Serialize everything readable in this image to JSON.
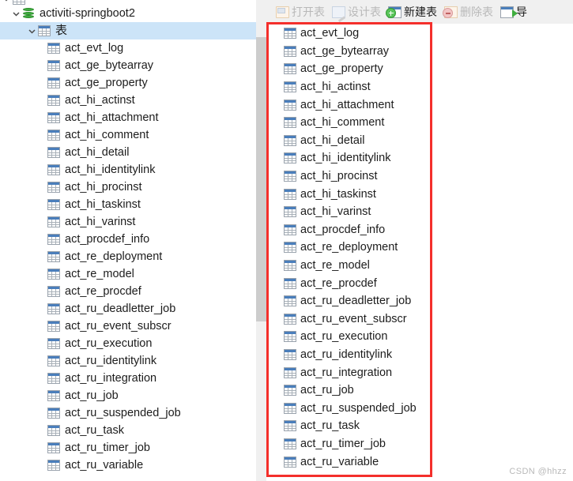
{
  "window": {
    "watermark": "CSDN @hhzz"
  },
  "toolbar": {
    "items": [
      {
        "label": "打开表",
        "icon": "open-table-icon",
        "disabled": true,
        "name": "open-table-button"
      },
      {
        "label": "设计表",
        "icon": "design-table-icon",
        "disabled": true,
        "name": "design-table-button"
      },
      {
        "label": "新建表",
        "icon": "new-table-icon",
        "disabled": false,
        "name": "new-table-button"
      },
      {
        "label": "删除表",
        "icon": "delete-table-icon",
        "disabled": true,
        "name": "delete-table-button"
      },
      {
        "label": "导",
        "icon": "import-icon",
        "disabled": false,
        "name": "import-button"
      }
    ]
  },
  "tree": {
    "connection": {
      "label": "activiti-springboot2",
      "icon": "database-icon",
      "expanded": true,
      "twisty": "chevron-down-icon"
    },
    "tables_node": {
      "label": "表",
      "icon": "table-folder-icon",
      "expanded": true,
      "twisty": "chevron-down-icon",
      "selected": true
    },
    "tables": [
      "act_evt_log",
      "act_ge_bytearray",
      "act_ge_property",
      "act_hi_actinst",
      "act_hi_attachment",
      "act_hi_comment",
      "act_hi_detail",
      "act_hi_identitylink",
      "act_hi_procinst",
      "act_hi_taskinst",
      "act_hi_varinst",
      "act_procdef_info",
      "act_re_deployment",
      "act_re_model",
      "act_re_procdef",
      "act_ru_deadletter_job",
      "act_ru_event_subscr",
      "act_ru_execution",
      "act_ru_identitylink",
      "act_ru_integration",
      "act_ru_job",
      "act_ru_suspended_job",
      "act_ru_task",
      "act_ru_timer_job",
      "act_ru_variable"
    ]
  },
  "table_list": {
    "tables": [
      "act_evt_log",
      "act_ge_bytearray",
      "act_ge_property",
      "act_hi_actinst",
      "act_hi_attachment",
      "act_hi_comment",
      "act_hi_detail",
      "act_hi_identitylink",
      "act_hi_procinst",
      "act_hi_taskinst",
      "act_hi_varinst",
      "act_procdef_info",
      "act_re_deployment",
      "act_re_model",
      "act_re_procdef",
      "act_ru_deadletter_job",
      "act_ru_event_subscr",
      "act_ru_execution",
      "act_ru_identitylink",
      "act_ru_integration",
      "act_ru_job",
      "act_ru_suspended_job",
      "act_ru_task",
      "act_ru_timer_job",
      "act_ru_variable"
    ]
  },
  "annotation": {
    "color": "#f42f2b",
    "shape": "rectangle"
  },
  "colors": {
    "selection": "#cce4f8",
    "toolbar_bg": "#f0f0f0",
    "scrollbar_thumb": "#cdcdcd",
    "table_icon_header": "#4a7ebb",
    "db_icon": "#3fae3f"
  }
}
